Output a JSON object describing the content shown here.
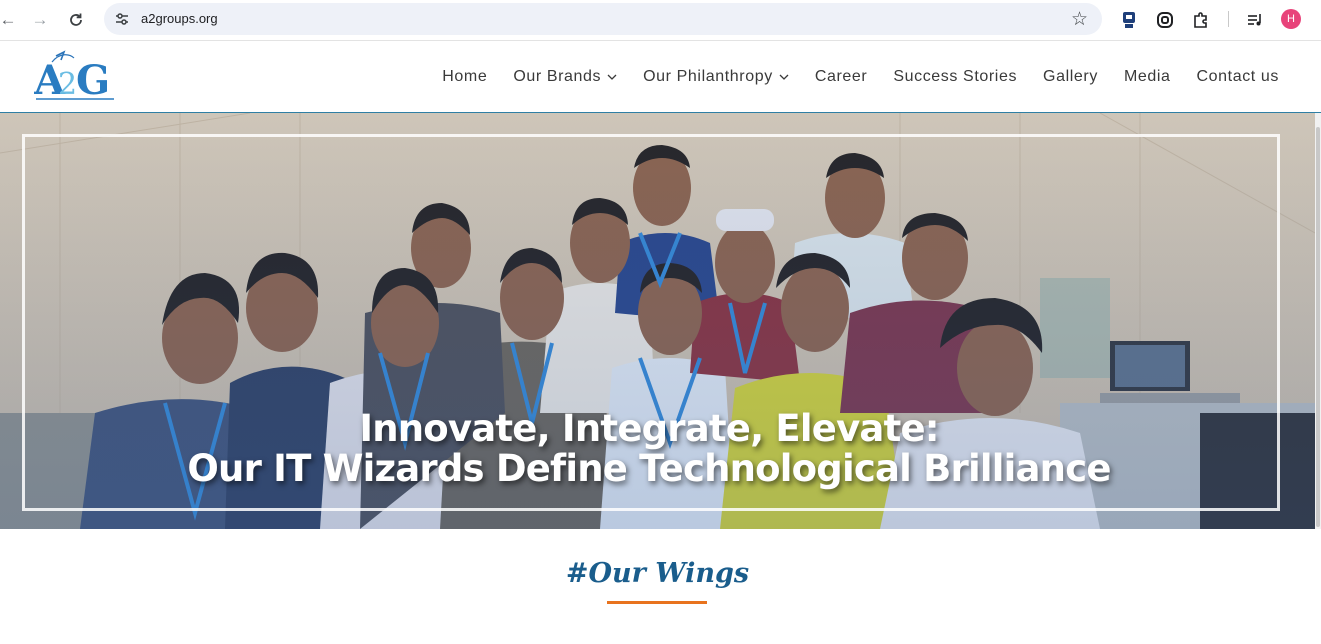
{
  "browser": {
    "url": "a2groups.org",
    "profile_initial": "H",
    "icons": [
      "back-icon",
      "forward-icon",
      "reload-icon",
      "site-settings-icon",
      "bookmark-star-icon",
      "extension-icon",
      "copilot-icon",
      "puzzle-icon",
      "media-queue-icon"
    ]
  },
  "site": {
    "logo_text": "A2G",
    "nav": [
      {
        "label": "Home",
        "dropdown": false
      },
      {
        "label": "Our Brands",
        "dropdown": true
      },
      {
        "label": "Our Philanthropy",
        "dropdown": true
      },
      {
        "label": "Career",
        "dropdown": false
      },
      {
        "label": "Success Stories",
        "dropdown": false
      },
      {
        "label": "Gallery",
        "dropdown": false
      },
      {
        "label": "Media",
        "dropdown": false
      },
      {
        "label": "Contact us",
        "dropdown": false
      }
    ]
  },
  "hero": {
    "line1": "Innovate, Integrate, Elevate:",
    "line2": "Our IT Wizards Define Technological Brilliance"
  },
  "section": {
    "title": "#Our Wings"
  },
  "colors": {
    "brand_blue": "#1a5d8c",
    "accent_orange": "#e8731e",
    "header_border": "#2f7fa4"
  }
}
